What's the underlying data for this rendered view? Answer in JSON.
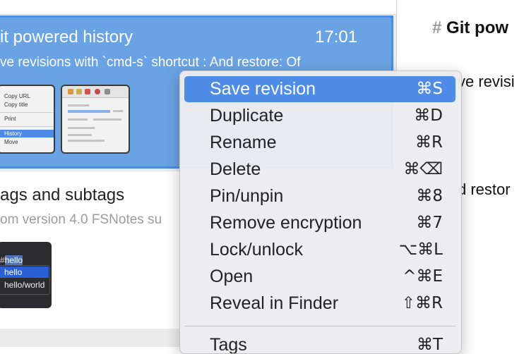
{
  "notes": [
    {
      "title": "it powered history",
      "time": "17:01",
      "excerpt": "ve revisions with `cmd-s` shortcut : And restore: Of",
      "thumb_menu": [
        "Copy URL",
        "Copy title",
        "Print",
        "History",
        "Move"
      ]
    },
    {
      "title": "ags and subtags",
      "excerpt": "om version 4.0 FSNotes su",
      "thumb_tags": {
        "hash_prefix": "#",
        "hash_selected": "hello",
        "rows": [
          "hello",
          "hello/world"
        ]
      }
    }
  ],
  "editor": {
    "heading_hash": "#",
    "heading_text": "Git pow",
    "line1": "ve revisi",
    "line2": "d restor"
  },
  "context_menu": {
    "items": [
      {
        "label": "Save revision",
        "shortcut": "⌘S",
        "highlighted": true
      },
      {
        "label": "Duplicate",
        "shortcut": "⌘D"
      },
      {
        "label": "Rename",
        "shortcut": "⌘R"
      },
      {
        "label": "Delete",
        "shortcut": "⌘⌫"
      },
      {
        "label": "Pin/unpin",
        "shortcut": "⌘8"
      },
      {
        "label": "Remove encryption",
        "shortcut": "⌘7"
      },
      {
        "label": "Lock/unlock",
        "shortcut": "⌥⌘L"
      },
      {
        "label": "Open",
        "shortcut": "^⌘E"
      },
      {
        "label": "Reveal in Finder",
        "shortcut": "⇧⌘R"
      },
      {
        "label": "Tags",
        "shortcut": "⌘T"
      }
    ]
  },
  "colors": {
    "highlight": "#4e8ce8",
    "selected_card": "#6aa3e3"
  }
}
